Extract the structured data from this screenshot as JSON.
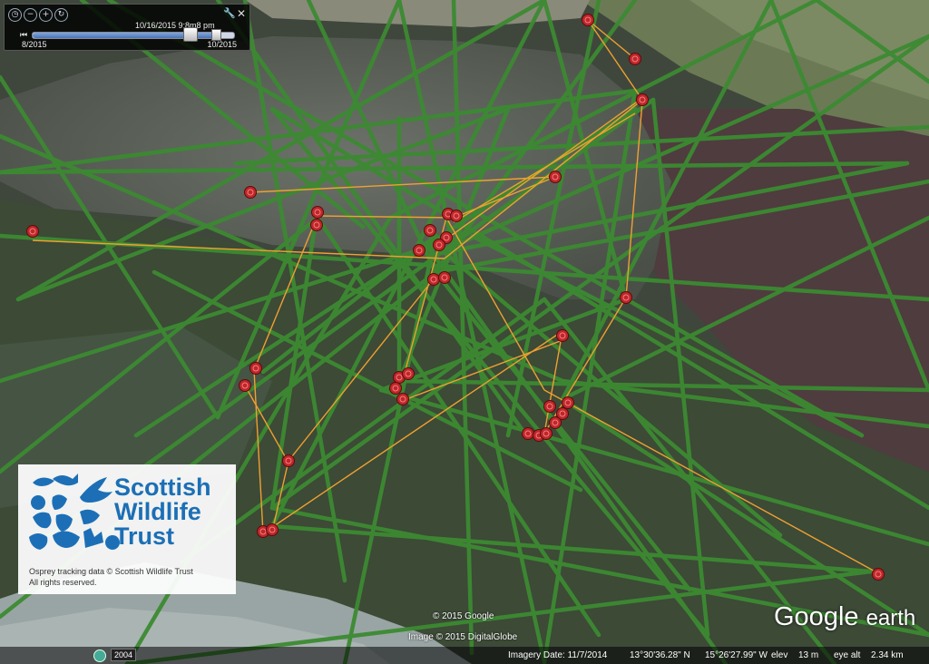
{
  "time_slider": {
    "current_label": "10/16/2015 9:8m8 pm",
    "start_label": "8/2015",
    "end_label": "10/2015",
    "position": 0.9
  },
  "logo": {
    "line1": "Scottish",
    "line2": "Wildlife",
    "line3": "Trust",
    "credit1": "Osprey tracking data © Scottish Wildlife Trust",
    "credit2": "All rights reserved."
  },
  "copyright": "© 2015 Google",
  "image_credit": "Image © 2015 DigitalGlobe",
  "brand": {
    "google": "Google",
    "earth": "earth"
  },
  "historical": {
    "year": "2004"
  },
  "status": {
    "imagery_date": "Imagery Date: 11/7/2014",
    "lat": "13°30'36.28\" N",
    "lon": "15°26'27.99\" W",
    "elev_label": "elev",
    "elev": "13 m",
    "eye_label": "eye alt",
    "eye": "2.34 km"
  },
  "colors": {
    "track_green": "#3c8a32",
    "track_orange": "#f0a030",
    "marker_red": "#c0262a",
    "logo_blue": "#1c6fb6"
  },
  "icons": [
    "clock-icon",
    "zoom-out-icon",
    "zoom-in-icon",
    "refresh-icon",
    "wrench-icon",
    "close-icon",
    "history-icon"
  ]
}
